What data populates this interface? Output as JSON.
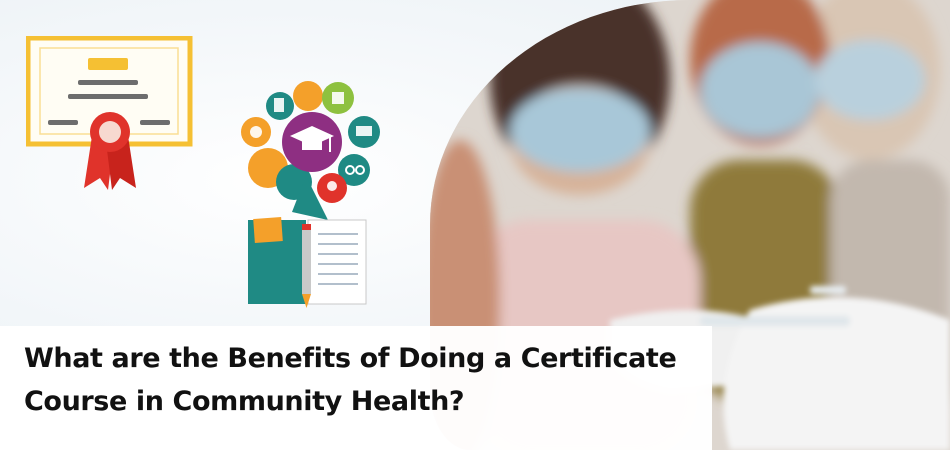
{
  "banner": {
    "headline": "What are the Benefits of Doing a Certificate Course in Community Health?"
  },
  "icons": {
    "certificate": "certificate-icon",
    "education_bubbles": "education-speech-bubbles-icon",
    "notebook": "notebook-with-pen-icon"
  },
  "colors": {
    "certificate_border": "#f5c033",
    "ribbon": "#e0332b",
    "teal": "#1f8a84",
    "purple": "#8e2f82",
    "orange": "#f4a02a",
    "text": "#111111"
  }
}
